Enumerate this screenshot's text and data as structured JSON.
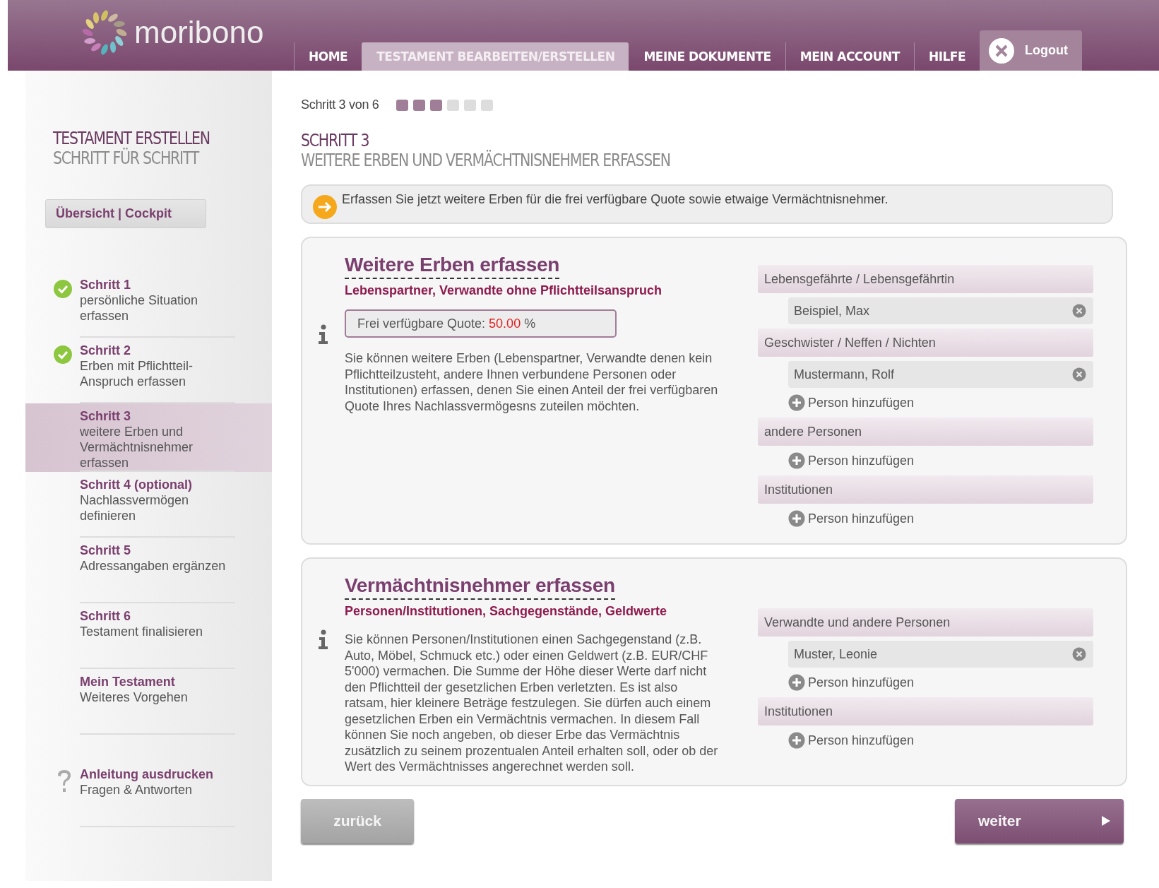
{
  "header": {
    "logo": "moribono",
    "nav": [
      {
        "label": "HOME",
        "selected": false
      },
      {
        "label": "TESTAMENT BEARBEITEN/ERSTELLEN",
        "selected": true
      },
      {
        "label": "MEINE DOKUMENTE",
        "selected": false
      },
      {
        "label": "MEIN ACCOUNT",
        "selected": false
      },
      {
        "label": "HILFE",
        "selected": false
      }
    ],
    "logout": "Logout"
  },
  "sidebar": {
    "title": "TESTAMENT ERSTELLEN",
    "subtitle": "SCHRITT FÜR SCHRITT",
    "overview_button": "Übersicht | Cockpit",
    "items": [
      {
        "kind": "step",
        "title": "Schritt 1",
        "text": "persönliche Situation erfassen",
        "completed": true,
        "selected": false
      },
      {
        "kind": "step",
        "title": "Schritt 2",
        "text": "Erben mit Pflichtteil-Anspruch erfassen",
        "completed": true,
        "selected": false
      },
      {
        "kind": "step",
        "title": "Schritt 3",
        "text": "weitere Erben und Vermächtnisnehmer erfassen",
        "completed": false,
        "selected": true
      },
      {
        "kind": "step",
        "title": "Schritt 4 (optional)",
        "text": "Nachlassvermögen definieren",
        "completed": false,
        "selected": false
      },
      {
        "kind": "step",
        "title": "Schritt 5",
        "text": "Adressangaben ergänzen",
        "completed": false,
        "selected": false
      },
      {
        "kind": "step",
        "title": "Schritt 6",
        "text": "Testament finalisieren",
        "completed": false,
        "selected": false
      },
      {
        "kind": "step",
        "title": "Mein Testament",
        "text": "Weiteres Vorgehen",
        "completed": false,
        "selected": false
      },
      {
        "kind": "help",
        "title": "Anleitung ausdrucken",
        "text": "Fragen & Antworten",
        "selected": false
      }
    ]
  },
  "progress": {
    "label": "Schritt 3 von 6",
    "steps": [
      {
        "done": true
      },
      {
        "done": true
      },
      {
        "done": true
      },
      {
        "done": false
      },
      {
        "done": false
      },
      {
        "done": false
      }
    ]
  },
  "page_title": "SCHRITT 3",
  "page_subtitle": "WEITERE ERBEN UND VERMÄCHTNISNEHMER ERFASSEN",
  "notice": "Erfassen Sie jetzt weitere Erben für die frei verfügbare Quote sowie etwaige Vermächtnisnehmer.",
  "sections": [
    {
      "title": "Weitere Erben erfassen",
      "subtitle": "Lebenspartner, Verwandte ohne Pflichtteilsanspruch",
      "quote": {
        "label": "Frei verfügbare Quote:",
        "value": "50.00",
        "unit": "%"
      },
      "description": "Sie können weitere Erben (Lebenspartner, Verwandte denen kein Pflichtteilzusteht, andere Ihnen verbundene Personen oder Institutionen) erfassen, denen Sie einen Anteil der frei verfügbaren Quote Ihres Nachlassvermögesns zuteilen möchten.",
      "groups": [
        {
          "label": "Lebensgefährte / Lebensgefährtin",
          "persons": [
            "Beispiel, Max"
          ]
        },
        {
          "label": "Geschwister / Neffen / Nichten",
          "persons": [
            "Mustermann, Rolf"
          ],
          "add_label": "Person hinzufügen"
        },
        {
          "label": "andere Personen",
          "add_label": "Person hinzufügen"
        },
        {
          "label": "Institutionen",
          "add_label": "Person hinzufügen"
        }
      ]
    },
    {
      "title": "Vermächtnisnehmer erfassen",
      "subtitle": "Personen/Institutionen, Sachgegenstände, Geldwerte",
      "description": "Sie können Personen/Institutionen einen Sachgegenstand (z.B. Auto, Möbel, Schmuck etc.) oder einen Geldwert (z.B. EUR/CHF 5'000) vermachen. Die Summe der Höhe dieser Werte darf nicht den Pflichtteil der gesetzlichen Erben verletzten. Es ist also ratsam, hier kleinere Beträge festzulegen. Sie dürfen auch einem gesetzlichen Erben ein Vermächtnis vermachen. In diesem Fall können Sie noch angeben, ob dieser Erbe das Vermächtnis zusätzlich zu seinem prozentualen Anteil erhalten soll, oder ob der Wert des Vermächtnisses angerechnet werden soll.",
      "groups": [
        {
          "label": "Verwandte und andere Personen",
          "persons": [
            "Muster, Leonie"
          ],
          "add_label": "Person hinzufügen"
        },
        {
          "label": "Institutionen",
          "add_label": "Person hinzufügen"
        }
      ]
    }
  ],
  "buttons": {
    "back": "zurück",
    "next": "weiter"
  }
}
